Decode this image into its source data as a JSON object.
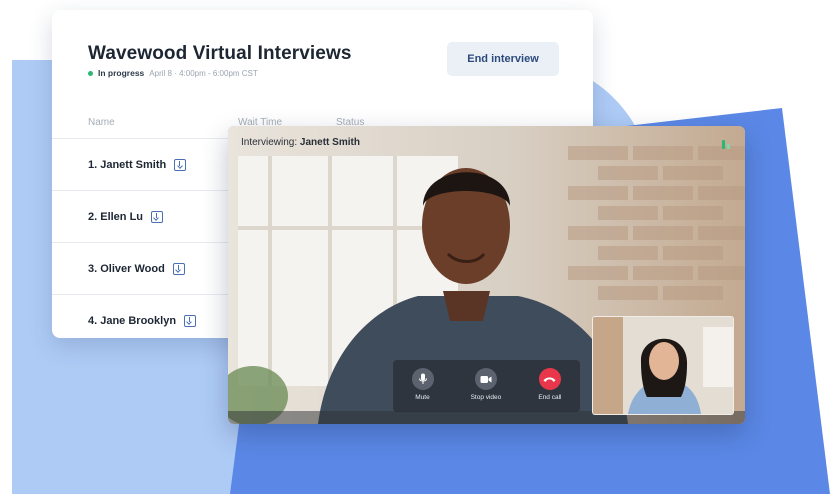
{
  "panel": {
    "title": "Wavewood Virtual Interviews",
    "status": "In progress",
    "schedule": "April 8 · 4:00pm - 6:00pm CST",
    "end_button": "End interview",
    "columns": [
      "Name",
      "Wait Time",
      "Status"
    ],
    "candidates": [
      {
        "label": "1. Janett Smith"
      },
      {
        "label": "2. Ellen Lu"
      },
      {
        "label": "3. Oliver Wood"
      },
      {
        "label": "4. Jane Brooklyn"
      }
    ]
  },
  "video": {
    "interviewing_prefix": "Interviewing: ",
    "interviewing_name": "Janett Smith",
    "controls": {
      "mute": "Mute",
      "stop_video": "Stop video",
      "end_call": "End call"
    },
    "brand_icon": "bar-chart-icon",
    "end_call_color": "#e8374b"
  },
  "colors": {
    "accent_light": "#aecbf6",
    "accent_dark": "#5b88e6",
    "status_green": "#2bb673"
  }
}
